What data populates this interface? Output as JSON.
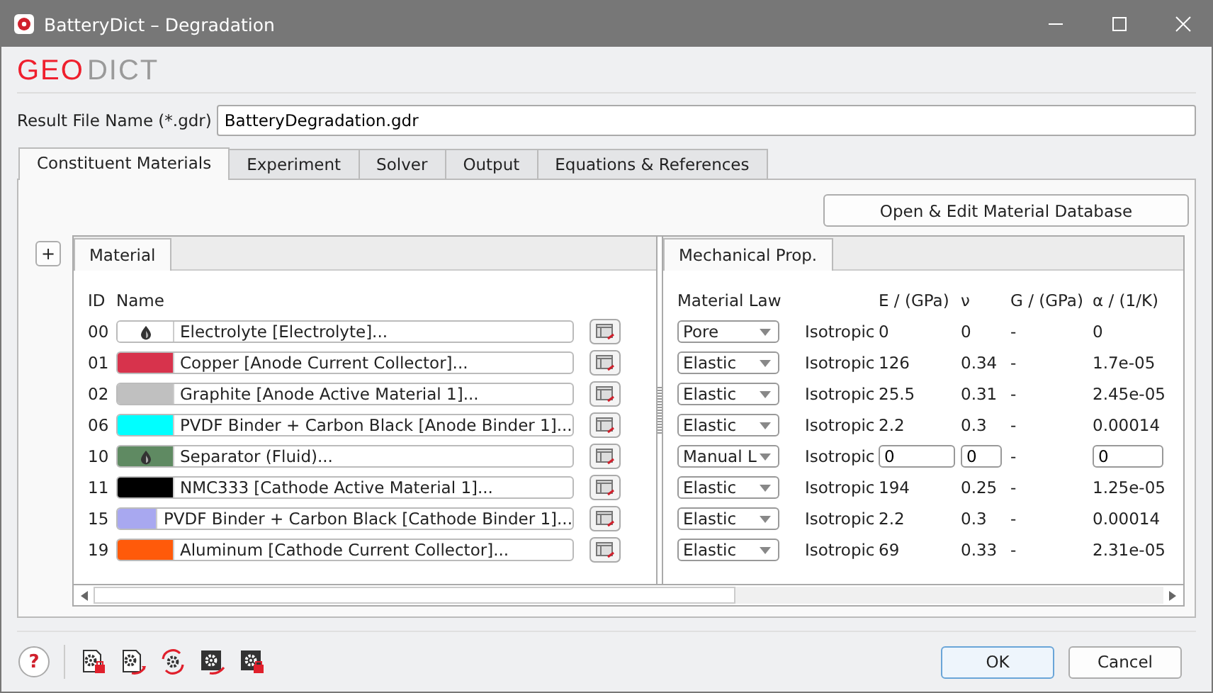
{
  "window": {
    "title": "BatteryDict – Degradation"
  },
  "logo": [
    {
      "text": "GEO",
      "kind": "accent"
    },
    {
      "text": "DICT",
      "kind": "plain"
    }
  ],
  "result_file": {
    "label": "Result File Name (*.gdr)",
    "value": "BatteryDegradation.gdr"
  },
  "tabs": [
    {
      "label": "Constituent Materials",
      "selected": true
    },
    {
      "label": "Experiment",
      "selected": false
    },
    {
      "label": "Solver",
      "selected": false
    },
    {
      "label": "Output",
      "selected": false
    },
    {
      "label": "Equations & References",
      "selected": false
    }
  ],
  "open_database_button": "Open & Edit Material Database",
  "add_button": "+",
  "material_pane": {
    "tab": "Material",
    "columns": [
      "ID",
      "Name"
    ],
    "rows": [
      {
        "id": "00",
        "name": "Electrolyte [Electrolyte]...",
        "color": "#ffffff",
        "fluid": true
      },
      {
        "id": "01",
        "name": "Copper [Anode Current Collector]...",
        "color": "#d7334c",
        "fluid": false
      },
      {
        "id": "02",
        "name": "Graphite [Anode Active Material 1]...",
        "color": "#c0c0c0",
        "fluid": false
      },
      {
        "id": "06",
        "name": "PVDF Binder + Carbon Black [Anode Binder 1]...",
        "color": "#00ffff",
        "fluid": false
      },
      {
        "id": "10",
        "name": "Separator (Fluid)...",
        "color": "#5f8a62",
        "fluid": true
      },
      {
        "id": "11",
        "name": "NMC333 [Cathode Active Material 1]...",
        "color": "#000000",
        "fluid": false
      },
      {
        "id": "15",
        "name": "PVDF Binder + Carbon Black [Cathode Binder 1]...",
        "color": "#a8a8f0",
        "fluid": false
      },
      {
        "id": "19",
        "name": "Aluminum [Cathode Current Collector]...",
        "color": "#ff5a0a",
        "fluid": false
      }
    ]
  },
  "mechanical_pane": {
    "tab": "Mechanical Prop.",
    "columns": [
      "Material Law",
      "E / (GPa)",
      "ν",
      "G / (GPa)",
      "α / (1/K)"
    ],
    "rows": [
      {
        "law": "Pore",
        "symmetry": "Isotropic",
        "e": "0",
        "nu": "0",
        "g": "-",
        "alpha": "0",
        "editable": false
      },
      {
        "law": "Elastic",
        "symmetry": "Isotropic",
        "e": "126",
        "nu": "0.34",
        "g": "-",
        "alpha": "1.7e-05",
        "editable": false
      },
      {
        "law": "Elastic",
        "symmetry": "Isotropic",
        "e": "25.5",
        "nu": "0.31",
        "g": "-",
        "alpha": "2.45e-05",
        "editable": false
      },
      {
        "law": "Elastic",
        "symmetry": "Isotropic",
        "e": "2.2",
        "nu": "0.3",
        "g": "-",
        "alpha": "0.00014",
        "editable": false
      },
      {
        "law": "Manual L",
        "symmetry": "Isotropic",
        "e": "0",
        "nu": "0",
        "g": "-",
        "alpha": "0",
        "editable": true
      },
      {
        "law": "Elastic",
        "symmetry": "Isotropic",
        "e": "194",
        "nu": "0.25",
        "g": "-",
        "alpha": "1.25e-05",
        "editable": false
      },
      {
        "law": "Elastic",
        "symmetry": "Isotropic",
        "e": "2.2",
        "nu": "0.3",
        "g": "-",
        "alpha": "0.00014",
        "editable": false
      },
      {
        "law": "Elastic",
        "symmetry": "Isotropic",
        "e": "69",
        "nu": "0.33",
        "g": "-",
        "alpha": "2.31e-05",
        "editable": false
      }
    ]
  },
  "help_button": "?",
  "buttons": [
    "OK",
    "Cancel"
  ]
}
